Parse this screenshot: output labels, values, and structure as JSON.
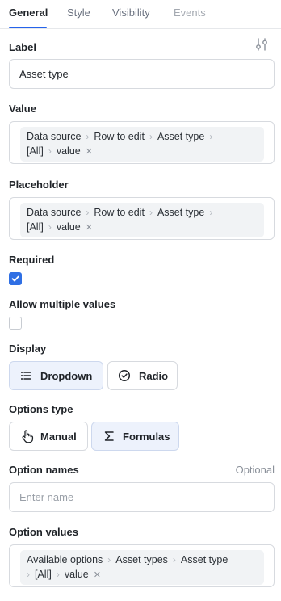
{
  "tabs": [
    {
      "label": "General",
      "state": "active"
    },
    {
      "label": "Style",
      "state": "normal"
    },
    {
      "label": "Visibility",
      "state": "normal"
    },
    {
      "label": "Events",
      "state": "disabled"
    }
  ],
  "label_field": {
    "title": "Label",
    "value": "Asset type",
    "icon": "sliders-icon"
  },
  "value_field": {
    "title": "Value",
    "line1": [
      "Data source",
      "Row to edit",
      "Asset type"
    ],
    "line2": [
      "[All]",
      "value"
    ]
  },
  "placeholder_field": {
    "title": "Placeholder",
    "line1": [
      "Data source",
      "Row to edit",
      "Asset type"
    ],
    "line2": [
      "[All]",
      "value"
    ]
  },
  "required": {
    "title": "Required",
    "checked": true
  },
  "allow_multiple": {
    "title": "Allow multiple values",
    "checked": false
  },
  "display": {
    "title": "Display",
    "options": [
      {
        "label": "Dropdown",
        "icon": "list-icon",
        "selected": true
      },
      {
        "label": "Radio",
        "icon": "check-circle-icon",
        "selected": false
      }
    ]
  },
  "options_type": {
    "title": "Options type",
    "options": [
      {
        "label": "Manual",
        "icon": "pointer-hand-icon",
        "selected": false
      },
      {
        "label": "Formulas",
        "icon": "sigma-icon",
        "selected": true
      }
    ]
  },
  "option_names": {
    "title": "Option names",
    "optional_label": "Optional",
    "placeholder": "Enter name"
  },
  "option_values": {
    "title": "Option values",
    "line1": [
      "Available options",
      "Asset types",
      "Asset type"
    ],
    "line2": [
      "[All]",
      "value"
    ]
  },
  "colors": {
    "accent": "#2563eb",
    "checkbox": "#2f6fe4",
    "selected_button_bg": "#edf2fc"
  }
}
